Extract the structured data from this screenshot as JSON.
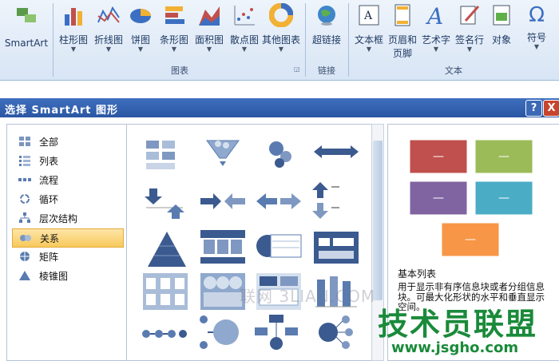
{
  "ribbon": {
    "smartart": "SmartArt",
    "charts": [
      "柱形图",
      "折线图",
      "饼图",
      "条形图",
      "面积图",
      "散点图",
      "其他图表"
    ],
    "chart_group": "图表",
    "link": "超链接",
    "link_group": "链接",
    "text_items": [
      "文本框",
      "页眉和\n页脚",
      "艺术字",
      "签名行",
      "对象",
      "符号"
    ],
    "text_header_footer_l1": "页眉和",
    "text_header_footer_l2": "页脚",
    "text_group": "文本"
  },
  "dialog": {
    "title": "选择 SmartArt 图形",
    "help_label": "?",
    "close_label": "X",
    "categories": [
      "全部",
      "列表",
      "流程",
      "循环",
      "层次结构",
      "关系",
      "矩阵",
      "棱锥图"
    ],
    "selected_category": "关系",
    "preview_name": "基本列表",
    "preview_desc": "用于显示非有序信息块或者分组信息块。可最大化形状的水平和垂直显示空间。",
    "preview_box_text": "—",
    "colors": {
      "red": "#c0504d",
      "green": "#9bbb59",
      "purple": "#8064a2",
      "teal": "#4bacc6",
      "orange": "#f79646"
    }
  },
  "watermarks": {
    "center": "联网 3LIAN.COM",
    "brand": "技术员联盟",
    "url": "www.jsgho.com"
  }
}
